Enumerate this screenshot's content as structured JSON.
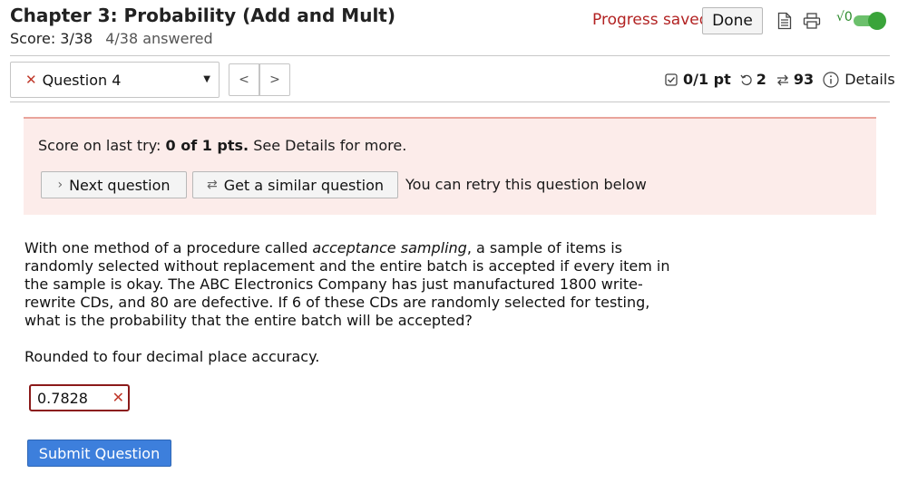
{
  "header": {
    "title": "Chapter 3: Probability (Add and Mult)",
    "score": "Score: 3/38",
    "answered": "4/38 answered",
    "progress_saved": "Progress saved",
    "done_label": "Done",
    "math_label": "√0"
  },
  "nav": {
    "question_label": "Question 4",
    "prev_label": "<",
    "next_label": ">",
    "points": "0/1 pt",
    "tries": "2",
    "versions": "93",
    "details_label": "Details"
  },
  "feedback": {
    "score_prefix": "Score on last try: ",
    "score_value": "0 of 1 pts.",
    "score_suffix": " See Details for more.",
    "next_question_label": "Next question",
    "similar_question_label": "Get a similar question",
    "retry_message": "You can retry this question below"
  },
  "question": {
    "text_part1": "With one method of a procedure called ",
    "text_emph": "acceptance sampling",
    "text_part2": ", a sample of items is randomly selected without replacement and the entire batch is accepted if every item in the sample is okay. The ABC Electronics Company has just manufactured 1800 write-rewrite CDs, and 80 are defective. If 6 of these CDs are randomly selected for testing, what is the probability that the entire batch will be accepted?",
    "instruction": "Rounded to four decimal place accuracy.",
    "answer_value": "0.7828",
    "submit_label": "Submit Question"
  },
  "colors": {
    "accent_blue": "#3d7fdc",
    "error_red": "#b22222",
    "feedback_bg": "#fcecea",
    "toggle_green": "#3aa43a"
  },
  "icons": {
    "question_status": "x-icon",
    "dropdown": "caret-down-icon",
    "points_status": "checkbox-icon",
    "tries": "retry-icon",
    "versions": "shuffle-icon",
    "details": "info-icon"
  }
}
